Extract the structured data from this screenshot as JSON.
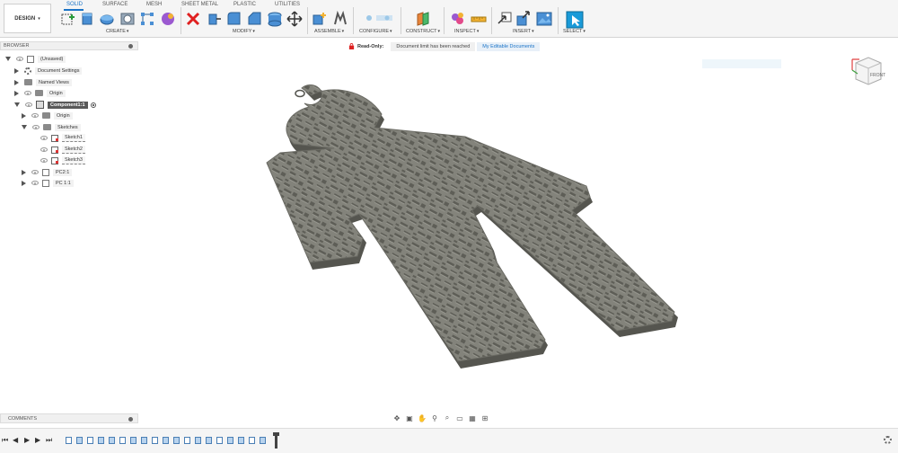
{
  "toolbar": {
    "workspace_button": "DESIGN",
    "tabs": [
      "SOLID",
      "SURFACE",
      "MESH",
      "SHEET METAL",
      "PLASTIC",
      "UTILITIES"
    ],
    "groups": [
      "CREATE",
      "MODIFY",
      "ASSEMBLE",
      "CONFIGURE",
      "CONSTRUCT",
      "INSPECT",
      "INSERT",
      "SELECT"
    ]
  },
  "banner": {
    "read_only": "Read-Only:",
    "message": "Document limit has been reached",
    "link": "My Editable Documents"
  },
  "browser": {
    "title": "BROWSER",
    "items": [
      {
        "label": "(Unsaved)"
      },
      {
        "label": "Document Settings"
      },
      {
        "label": "Named Views"
      },
      {
        "label": "Origin"
      },
      {
        "label": "Component1:1"
      },
      {
        "label": "Origin"
      },
      {
        "label": "Sketches"
      },
      {
        "label": "Sketch1"
      },
      {
        "label": "Sketch2"
      },
      {
        "label": "Sketch3"
      },
      {
        "label": "PC2:1"
      },
      {
        "label": "PC 1:1"
      }
    ]
  },
  "viewcube": {
    "face": "FRONT"
  },
  "comments": {
    "title": "COMMENTS"
  },
  "colors": {
    "accent": "#1a73c7",
    "model": "#7a7a72",
    "danger": "#e02020"
  }
}
